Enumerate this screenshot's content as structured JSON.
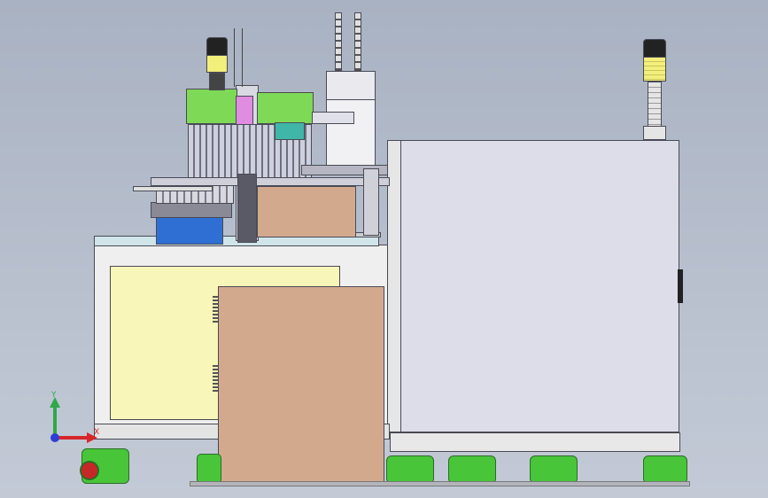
{
  "viewport": {
    "background_top": "#a9b2c2",
    "background_bottom": "#c3cad6"
  },
  "triad": {
    "y_label": "Y",
    "x_label": "X",
    "y_color": "#2fa84a",
    "x_color": "#d8252a",
    "z_color": "#2d3ed6"
  },
  "model": {
    "box_color": "#d3a98e",
    "frame_color": "#eeeeee",
    "panel_color": "#f8f6b8",
    "cabinet_color": "#dcdde8",
    "accent_green": "#7ed957",
    "tower_yellow": "#f2ef7a",
    "tower_stripe": "#222222",
    "caster_green": "#49c53a"
  }
}
